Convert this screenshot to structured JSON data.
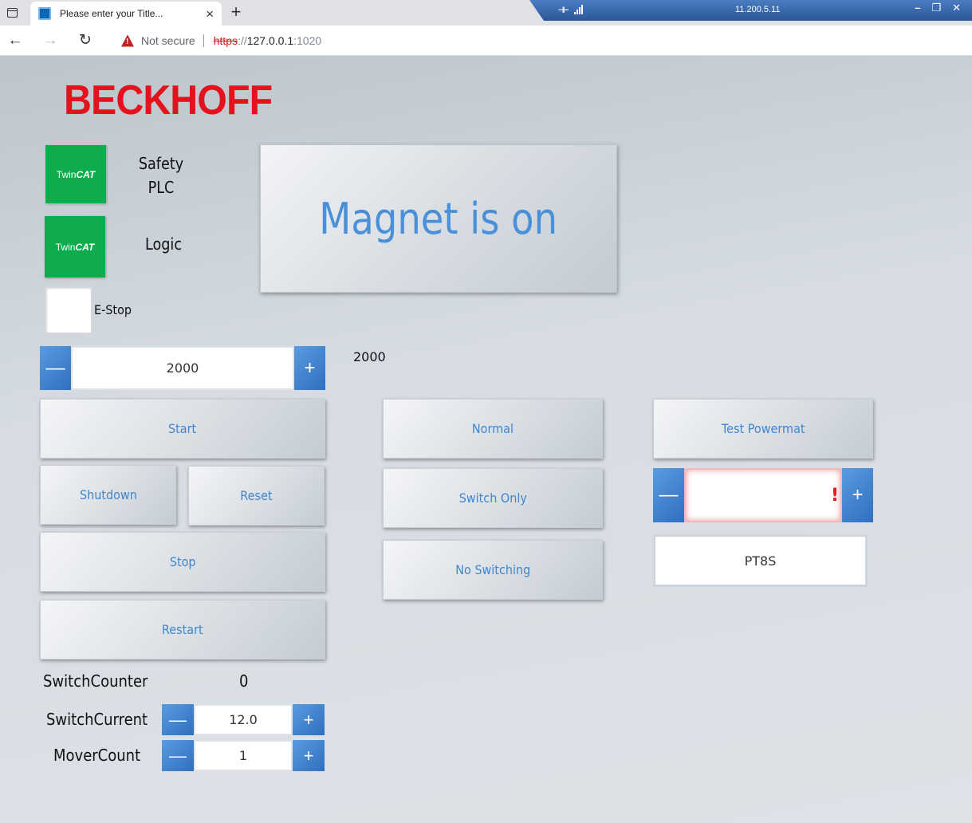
{
  "browser": {
    "tab_title": "Please enter your Title...",
    "tab_close": "×",
    "new_tab": "+",
    "not_secure": "Not secure",
    "url_scheme": "https",
    "url_sep": "://",
    "url_host": "127.0.0.1",
    "url_port": ":1020",
    "back": "←",
    "forward": "→",
    "reload": "↻"
  },
  "remote": {
    "host": "11.200.5.11",
    "pin": "⊣⊢",
    "minimize": "–",
    "restore": "❐",
    "close": "✕"
  },
  "app": {
    "logo": "BECKHOFF",
    "twincat_prefix": "Twin",
    "twincat_suffix": "CAT",
    "safety_plc_line1": "Safety",
    "safety_plc_line2": "PLC",
    "logic_label": "Logic",
    "estop_label": "E-Stop",
    "magnet_status": "Magnet is on",
    "setpoint_value": "2000",
    "setpoint_readout": "2000",
    "buttons": {
      "start": "Start",
      "shutdown": "Shutdown",
      "reset": "Reset",
      "stop": "Stop",
      "restart": "Restart",
      "normal": "Normal",
      "switch_only": "Switch Only",
      "no_switching": "No Switching",
      "test_powermat": "Test Powermat"
    },
    "powermat_value": "",
    "powermat_error": "!",
    "pt8s": "PT8S",
    "switch_counter_label": "SwitchCounter",
    "switch_counter_value": "0",
    "switch_current_label": "SwitchCurrent",
    "switch_current_value": "12.0",
    "mover_count_label": "MoverCount",
    "mover_count_value": "1",
    "minus": "—",
    "plus": "+"
  },
  "colors": {
    "brand_red": "#e3121c",
    "twincat_green": "#0eac4c",
    "accent_blue": "#4a90d9",
    "spin_blue": "#3f7fcc",
    "error_red": "#e01818"
  }
}
